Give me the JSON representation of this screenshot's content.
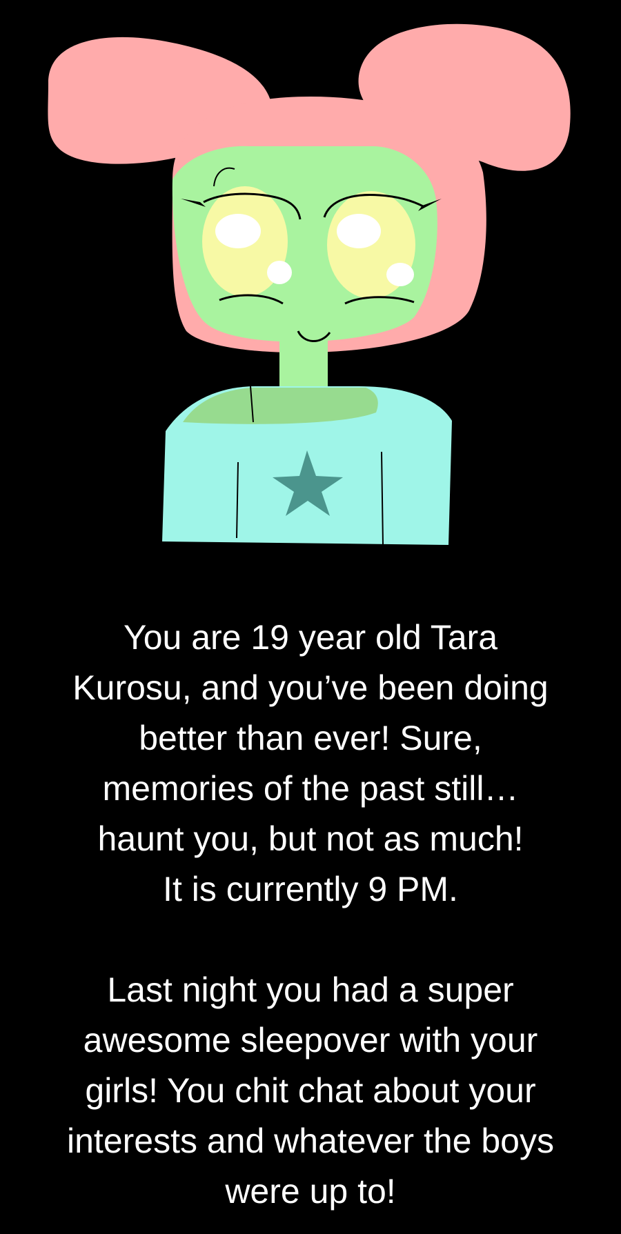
{
  "illustration": {
    "subject": "character-portrait",
    "colors": {
      "background": "#000000",
      "hair": "#ffabab",
      "skin": "#a9f39f",
      "skin_shadow": "#97db8f",
      "eye_sclera": "#f7f9a5",
      "eye_highlight": "#ffffff",
      "shirt": "#9ff5e8",
      "star": "#4b958d",
      "line": "#000000"
    }
  },
  "story": {
    "paragraph1": [
      "You are 19 year old Tara",
      "Kurosu, and you’ve been doing",
      "better than ever! Sure,",
      "memories of the past still…",
      "haunt you, but not as much!",
      "It is currently 9 PM."
    ],
    "paragraph2": [
      "Last night you had a super",
      "awesome sleepover with your",
      "girls! You chit chat about your",
      "interests and whatever the boys",
      "were up to!"
    ]
  }
}
